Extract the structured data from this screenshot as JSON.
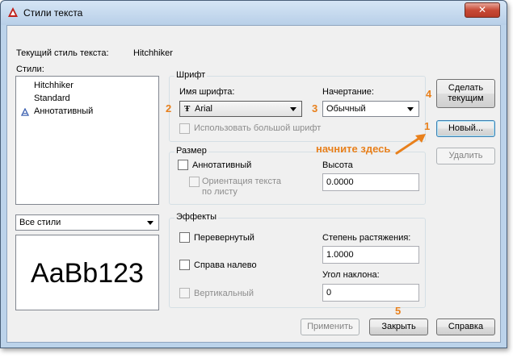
{
  "window": {
    "title": "Стили текста",
    "close_glyph": "✕"
  },
  "current_style": {
    "label": "Текущий стиль текста:",
    "value": "Hitchhiker"
  },
  "styles": {
    "label": "Стили:",
    "items": [
      {
        "label": "Hitchhiker",
        "annotative": false
      },
      {
        "label": "Standard",
        "annotative": false
      },
      {
        "label": "Аннотативный",
        "annotative": true
      }
    ],
    "filter_value": "Все стили",
    "preview_text": "AaBb123"
  },
  "font": {
    "group_label": "Шрифт",
    "name_label": "Имя шрифта:",
    "name_value": "Arial",
    "style_label": "Начертание:",
    "style_value": "Обычный",
    "bigfont_label": "Использовать большой шрифт",
    "bigfont_checked": false
  },
  "size": {
    "group_label": "Размер",
    "annotative_label": "Аннотативный",
    "annotative_checked": false,
    "orientation_label_line1": "Ориентация текста",
    "orientation_label_line2": "по листу",
    "height_label": "Высота",
    "height_value": "0.0000"
  },
  "effects": {
    "group_label": "Эффекты",
    "upside_down_label": "Перевернутый",
    "backwards_label": "Справа налево",
    "vertical_label": "Вертикальный",
    "width_factor_label": "Степень растяжения:",
    "width_factor_value": "1.0000",
    "oblique_label": "Угол наклона:",
    "oblique_value": "0"
  },
  "buttons": {
    "set_current_line1": "Сделать",
    "set_current_line2": "текущим",
    "new": "Новый...",
    "delete": "Удалить",
    "apply": "Применить",
    "close": "Закрыть",
    "help": "Справка"
  },
  "annotations": {
    "n1": "1",
    "n2": "2",
    "n3": "3",
    "n4": "4",
    "n5": "5",
    "hint": "начните здесь",
    "color": "#e8801c"
  },
  "colors": {
    "app_icon": "#c0201a",
    "title_bar": "#c7dbf0",
    "close_button": "#c74a36"
  }
}
